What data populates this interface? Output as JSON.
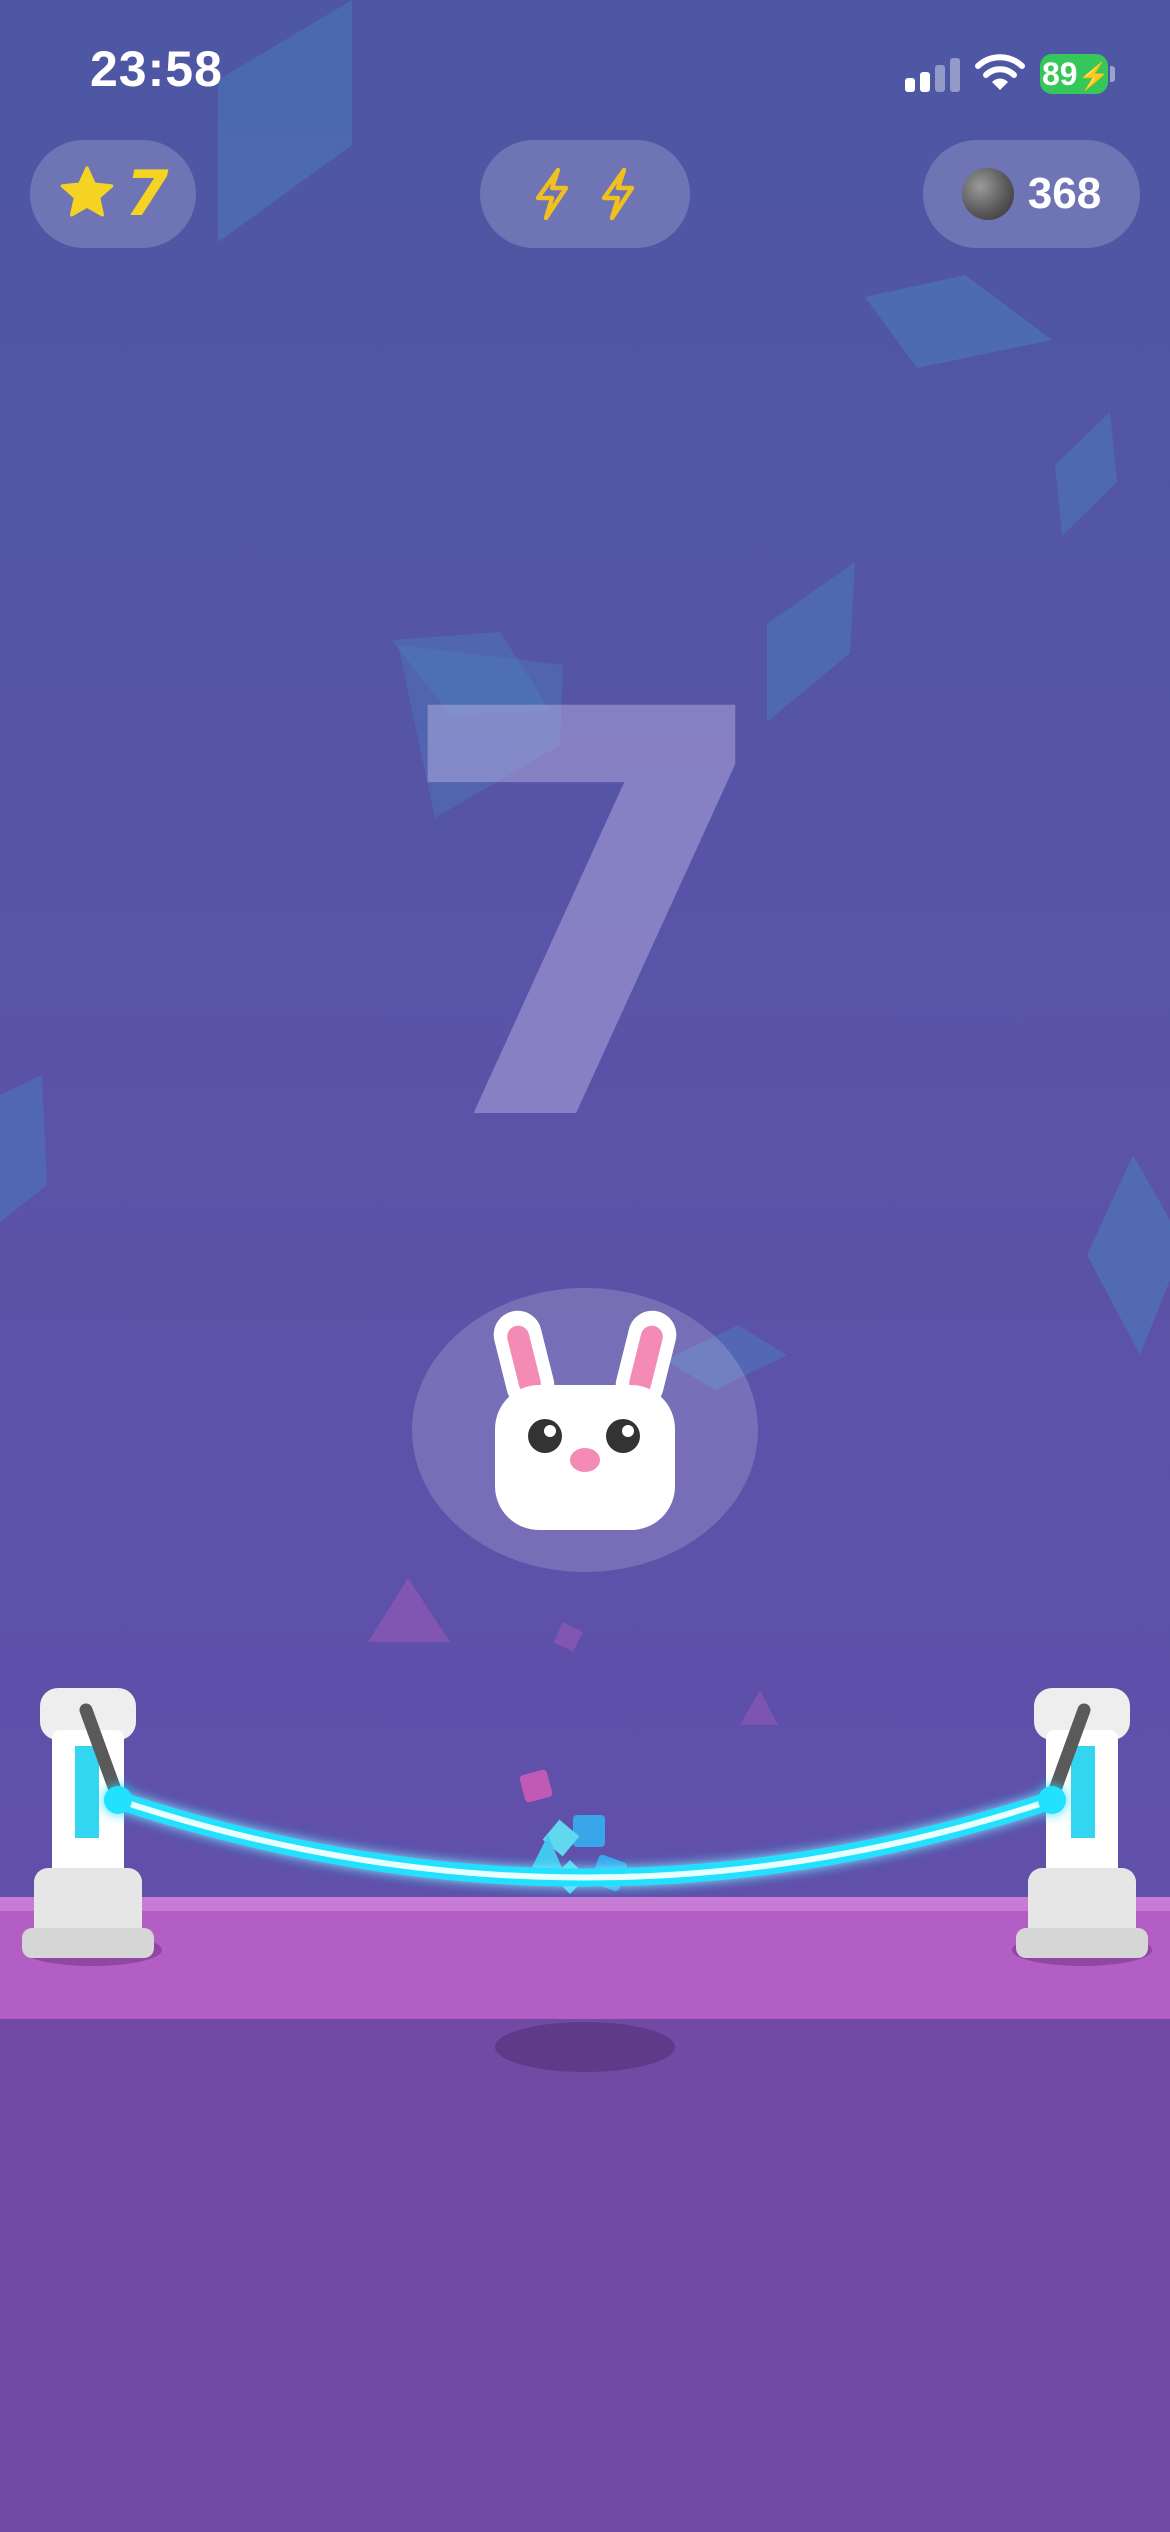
{
  "status_bar": {
    "time": "23:58",
    "battery_percent": "89",
    "signal_bars_active": 2,
    "signal_bars_total": 4,
    "icons": [
      "signal-icon",
      "wifi-icon",
      "battery-charging-icon"
    ]
  },
  "hud": {
    "stars": "7",
    "energy_icons": [
      "lightning-icon",
      "lightning-icon"
    ],
    "coins": "368"
  },
  "game": {
    "level_number": "7",
    "character": "bunny",
    "trampoline": "neon-rope-between-two-posts"
  },
  "colors": {
    "background": "#5a53a8",
    "star": "#f5d323",
    "energy": "#f0c020",
    "rope_glow": "#22e0ff",
    "floor": "#b25ec4",
    "floor_bottom": "#724aa4",
    "battery": "#35c759"
  }
}
